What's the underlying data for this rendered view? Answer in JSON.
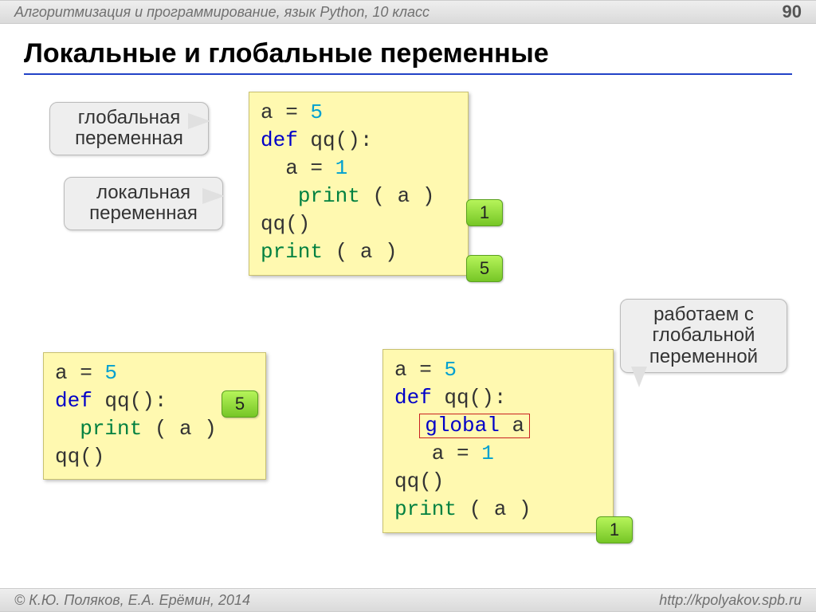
{
  "header": {
    "course": "Алгоритмизация и программирование, язык Python, 10 класс",
    "page": "90"
  },
  "title": "Локальные и глобальные переменные",
  "callouts": {
    "global_var": "глобальная\nпеременная",
    "local_var": "локальная\nпеременная",
    "work_global": "работаем с\nглобальной\nпеременной"
  },
  "badges": {
    "r1": "1",
    "r5a": "5",
    "r5b": "5",
    "r1b": "1"
  },
  "code1": {
    "l1_a": "a",
    "l1_eq": " = ",
    "l1_v": "5",
    "l2_def": "def",
    "l2_rest": " qq():",
    "l3": "  a",
    "l3_eq": " = ",
    "l3_v": "1",
    "l4_ind": "   ",
    "l4_fn": "print",
    "l4_rest": " ( a )",
    "l5": "qq()",
    "l6_fn": "print",
    "l6_rest": " ( a )"
  },
  "code2": {
    "l1_a": "a",
    "l1_eq": " = ",
    "l1_v": "5",
    "l2_def": "def",
    "l2_rest": " qq():",
    "l3_ind": "  ",
    "l3_fn": "print",
    "l3_rest": " ( a )",
    "l4": "qq()"
  },
  "code3": {
    "l1_a": "a",
    "l1_eq": " = ",
    "l1_v": "5",
    "l2_def": "def",
    "l2_rest": " qq():",
    "l3_ind": "  ",
    "l3_kw": "global",
    "l3_rest": " a",
    "l4": "   a",
    "l4_eq": " = ",
    "l4_v": "1",
    "l5": "qq()",
    "l6_fn": "print",
    "l6_rest": " ( a )"
  },
  "footer": {
    "copyright": "© К.Ю. Поляков, Е.А. Ерёмин, 2014",
    "url": "http://kpolyakov.spb.ru"
  }
}
